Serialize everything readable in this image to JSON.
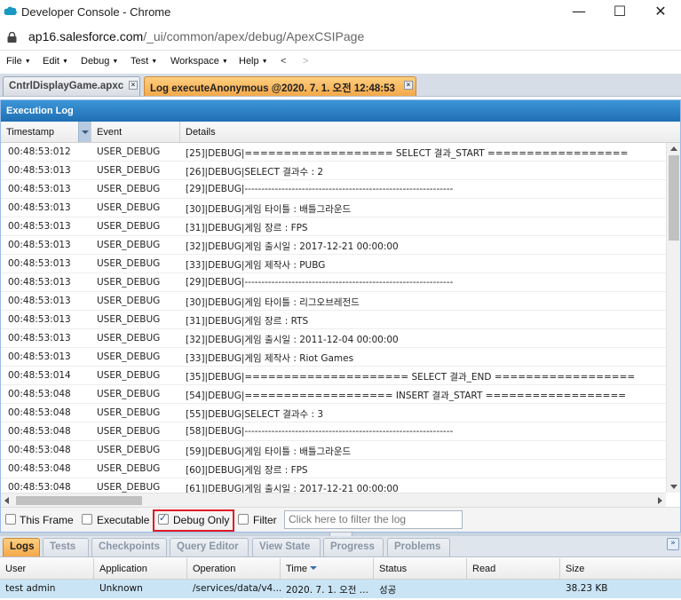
{
  "window": {
    "title": "Developer Console - Chrome",
    "minimize": "—",
    "maximize": "☐",
    "close": "✕"
  },
  "address": {
    "host": "ap16.salesforce.com",
    "path": "/_ui/common/apex/debug/ApexCSIPage"
  },
  "menu": {
    "items": [
      "File",
      "Edit",
      "Debug",
      "Test",
      "Workspace",
      "Help"
    ],
    "back": "<",
    "forward": ">"
  },
  "file_tabs": [
    {
      "label": "CntrlDisplayGame.apxc",
      "active": false
    },
    {
      "label": "Log executeAnonymous @2020. 7. 1. 오전 12:48:53",
      "active": true
    }
  ],
  "log": {
    "header": "Execution Log",
    "columns": [
      "Timestamp",
      "Event",
      "Details"
    ],
    "rows": [
      [
        "00:48:53:012",
        "USER_DEBUG",
        "[25]|DEBUG|=================== SELECT 결과_START =================="
      ],
      [
        "00:48:53:013",
        "USER_DEBUG",
        "[26]|DEBUG|SELECT 결과수 : 2"
      ],
      [
        "00:48:53:013",
        "USER_DEBUG",
        "[29]|DEBUG|--------------------------------------------------------------"
      ],
      [
        "00:48:53:013",
        "USER_DEBUG",
        "[30]|DEBUG|게임 타이틀 : 배틀그라운드"
      ],
      [
        "00:48:53:013",
        "USER_DEBUG",
        "[31]|DEBUG|게임 장르 : FPS"
      ],
      [
        "00:48:53:013",
        "USER_DEBUG",
        "[32]|DEBUG|게임 출시일 : 2017-12-21 00:00:00"
      ],
      [
        "00:48:53:013",
        "USER_DEBUG",
        "[33]|DEBUG|게임 제작사 : PUBG"
      ],
      [
        "00:48:53:013",
        "USER_DEBUG",
        "[29]|DEBUG|--------------------------------------------------------------"
      ],
      [
        "00:48:53:013",
        "USER_DEBUG",
        "[30]|DEBUG|게임 타이틀 : 리그오브레전드"
      ],
      [
        "00:48:53:013",
        "USER_DEBUG",
        "[31]|DEBUG|게임 장르 : RTS"
      ],
      [
        "00:48:53:013",
        "USER_DEBUG",
        "[32]|DEBUG|게임 출시일 : 2011-12-04 00:00:00"
      ],
      [
        "00:48:53:013",
        "USER_DEBUG",
        "[33]|DEBUG|게임 제작사 : Riot Games"
      ],
      [
        "00:48:53:014",
        "USER_DEBUG",
        "[35]|DEBUG|===================== SELECT 결과_END =================="
      ],
      [
        "00:48:53:048",
        "USER_DEBUG",
        "[54]|DEBUG|=================== INSERT 결과_START =================="
      ],
      [
        "00:48:53:048",
        "USER_DEBUG",
        "[55]|DEBUG|SELECT 결과수 : 3"
      ],
      [
        "00:48:53:048",
        "USER_DEBUG",
        "[58]|DEBUG|--------------------------------------------------------------"
      ],
      [
        "00:48:53:048",
        "USER_DEBUG",
        "[59]|DEBUG|게임 타이틀 : 배틀그라운드"
      ],
      [
        "00:48:53:048",
        "USER_DEBUG",
        "[60]|DEBUG|게임 장르 : FPS"
      ],
      [
        "00:48:53:048",
        "USER_DEBUG",
        "[61]|DEBUG|게임 출시일 : 2017-12-21 00:00:00"
      ]
    ]
  },
  "filter": {
    "this_frame": {
      "label": "This Frame",
      "checked": false
    },
    "executable": {
      "label": "Executable",
      "checked": false
    },
    "debug_only": {
      "label": "Debug Only",
      "checked": true
    },
    "filter": {
      "label": "Filter",
      "checked": false
    },
    "placeholder": "Click here to filter the log"
  },
  "bottom_tabs": [
    {
      "label": "Logs",
      "active": true
    },
    {
      "label": "Tests",
      "active": false
    },
    {
      "label": "Checkpoints",
      "active": false
    },
    {
      "label": "Query Editor",
      "active": false
    },
    {
      "label": "View State",
      "active": false
    },
    {
      "label": "Progress",
      "active": false
    },
    {
      "label": "Problems",
      "active": false
    }
  ],
  "logs_table": {
    "columns": [
      "User",
      "Application",
      "Operation",
      "Time",
      "Status",
      "Read",
      "Size"
    ],
    "rows": [
      [
        "test admin",
        "Unknown",
        "/services/data/v4...",
        "2020. 7. 1. 오전 ...",
        "성공",
        "",
        "38.23 KB"
      ]
    ]
  },
  "colors": {
    "accent_blue": "#1f6fb3",
    "active_tab": "#f3a84a",
    "highlight_row": "#c9e4f5",
    "debug_box": "#e01b24"
  }
}
